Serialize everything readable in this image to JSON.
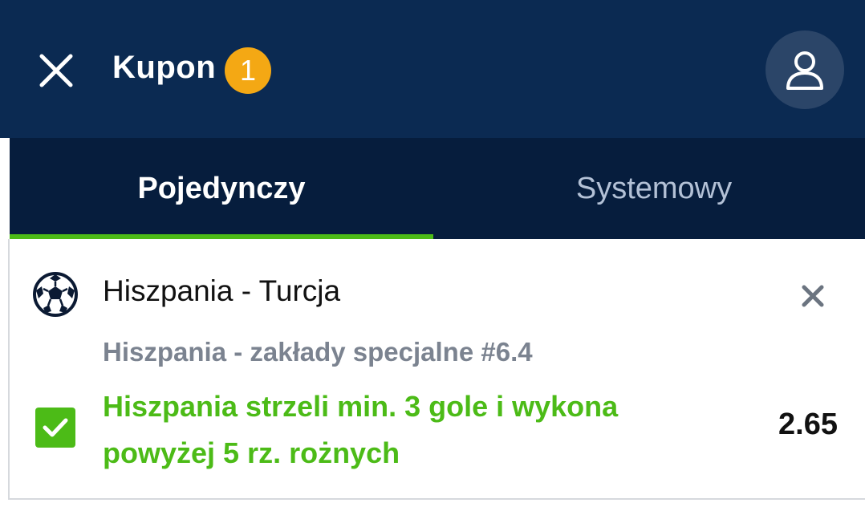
{
  "header": {
    "title": "Kupon",
    "badge_count": "1",
    "icons": {
      "close": "close-icon",
      "user": "user-icon"
    }
  },
  "tabs": [
    {
      "label": "Pojedynczy",
      "active": true
    },
    {
      "label": "Systemowy",
      "active": false
    }
  ],
  "bet": {
    "sport_icon": "football-icon",
    "match": "Hiszpania - Turcja",
    "market": "Hiszpania - zakłady specjalne #6.4",
    "selection": "Hiszpania strzeli min. 3 gole i wykona powyżej 5 rz. rożnych",
    "odds": "2.65",
    "checked": true
  },
  "colors": {
    "header_bg": "#0b2a52",
    "tabs_bg": "#061d3d",
    "badge": "#f4a814",
    "accent_green": "#4cbb17",
    "muted_text": "#7b8390"
  }
}
